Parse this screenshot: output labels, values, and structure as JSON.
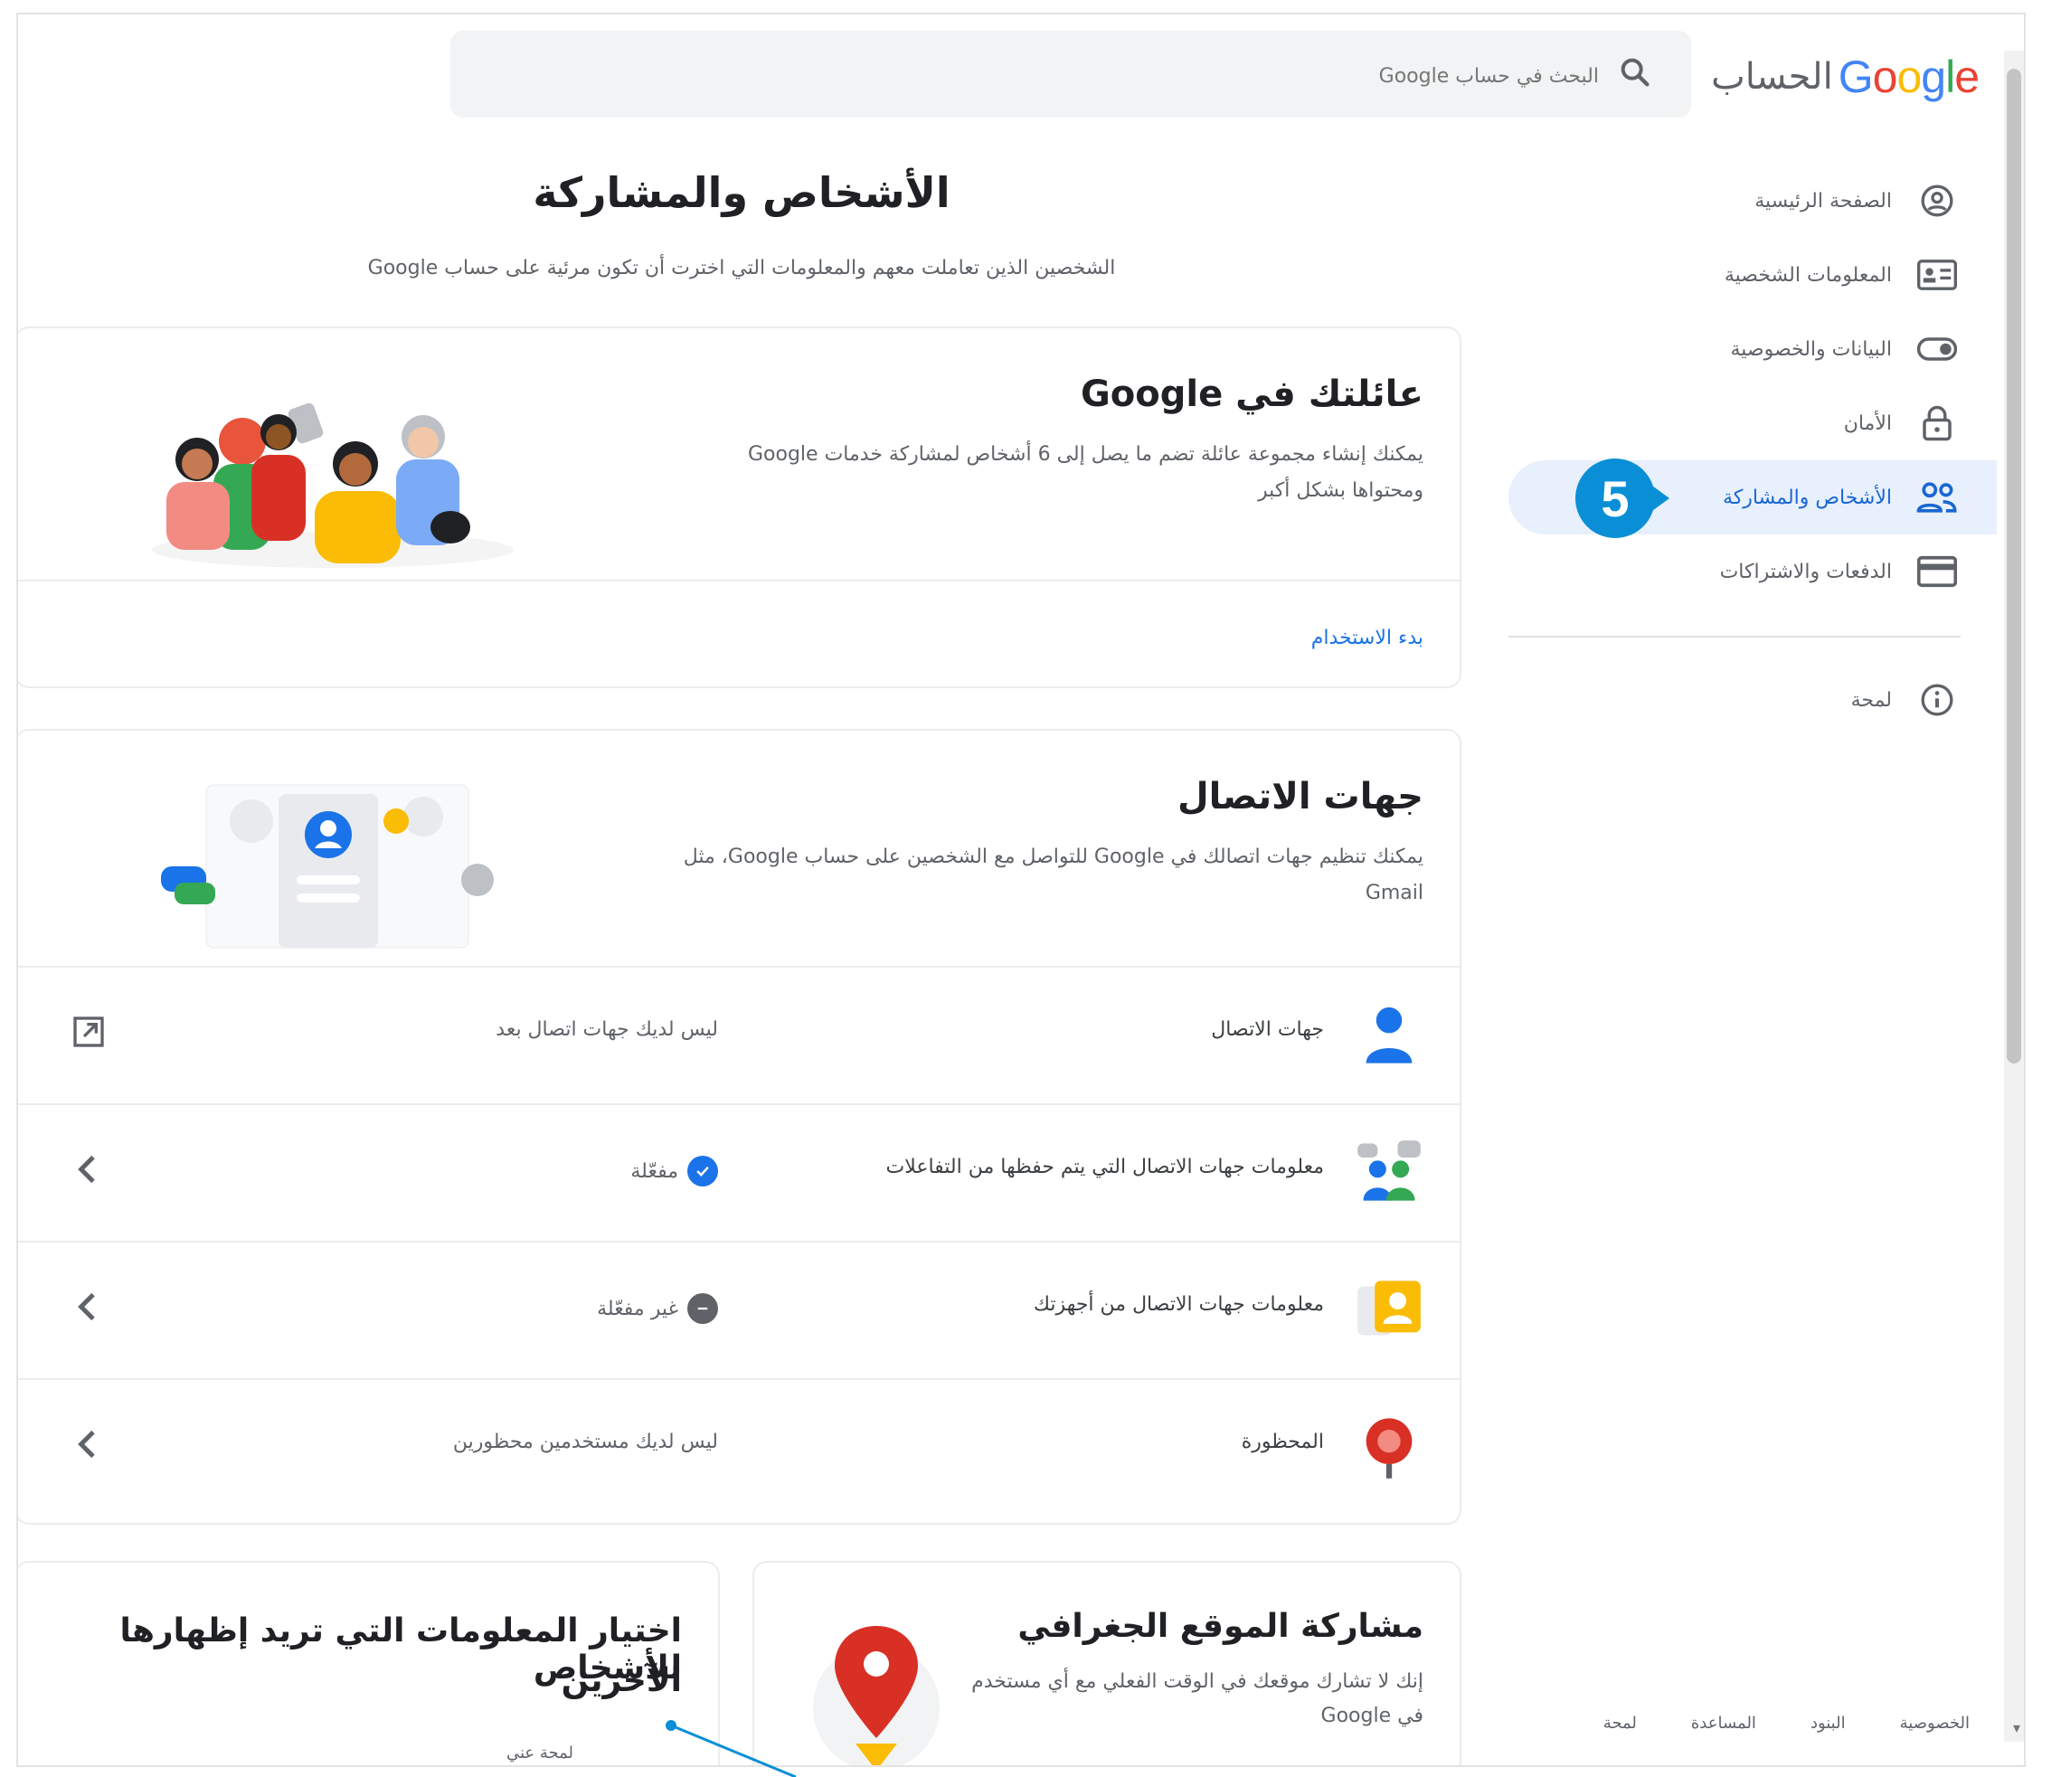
{
  "header": {
    "brand": "Google",
    "brand_suffix": "الحساب",
    "search_placeholder": "البحث في حساب Google"
  },
  "sidebar": {
    "items": [
      {
        "label": "الصفحة الرئيسية",
        "icon": "account-circle-icon"
      },
      {
        "label": "المعلومات الشخصية",
        "icon": "id-card-icon"
      },
      {
        "label": "البيانات والخصوصية",
        "icon": "toggle-icon"
      },
      {
        "label": "الأمان",
        "icon": "lock-icon"
      },
      {
        "label": "الأشخاص والمشاركة",
        "icon": "people-icon",
        "active": true
      },
      {
        "label": "الدفعات والاشتراكات",
        "icon": "credit-card-icon"
      }
    ],
    "help": {
      "label": "لمحة",
      "icon": "info-icon"
    },
    "step_badge": "5"
  },
  "main": {
    "title": "الأشخاص والمشاركة",
    "subtitle": "الشخصين الذين تعاملت معهم والمعلومات التي اخترت أن تكون مرئية على حساب Google",
    "family_card": {
      "title": "عائلتك في Google",
      "description_line1": "يمكنك إنشاء مجموعة عائلة تضم ما يصل إلى 6 أشخاص لمشاركة خدمات Google",
      "description_line2": "ومحتواها بشكل أكبر",
      "link": "بدء الاستخدام"
    },
    "contacts_card": {
      "title": "جهات الاتصال",
      "description_line1": "يمكنك تنظيم جهات اتصالك في Google للتواصل مع الشخصين على حساب Google، مثل",
      "description_line2": "Gmail",
      "rows": [
        {
          "label": "جهات الاتصال",
          "value": "ليس لديك جهات اتصال بعد",
          "icon": "contact-person-icon",
          "arrow": "open-external-icon"
        },
        {
          "label": "معلومات جهات الاتصال التي يتم حفظها من التفاعلات",
          "value": "مفعّلة",
          "status": "on",
          "icon": "interactions-icon",
          "arrow": "chevron-left-icon"
        },
        {
          "label": "معلومات جهات الاتصال من أجهزتك",
          "value": "غير مفعّلة",
          "status": "off",
          "icon": "device-contacts-icon",
          "arrow": "chevron-left-icon"
        },
        {
          "label": "المحظورة",
          "value": "ليس لديك مستخدمين محظورين",
          "icon": "blocked-icon",
          "arrow": "chevron-left-icon"
        }
      ]
    },
    "location_card": {
      "title": "مشاركة الموقع الجغرافي",
      "description_line1": "إنك لا تشارك موقعك في الوقت الفعلي مع أي مستخدم",
      "description_line2": "في Google"
    },
    "choose_card": {
      "title_line1": "اختيار المعلومات التي تريد إظهارها للأشخاص",
      "title_line2": "الآخرين",
      "link": "لمحة عني"
    }
  },
  "footer": {
    "links": [
      "الخصوصية",
      "البنود",
      "المساعدة",
      "لمحة"
    ]
  },
  "colors": {
    "accent": "#1a73e8",
    "badge": "#0a8fd6",
    "active_bg": "#e8f0fe"
  }
}
